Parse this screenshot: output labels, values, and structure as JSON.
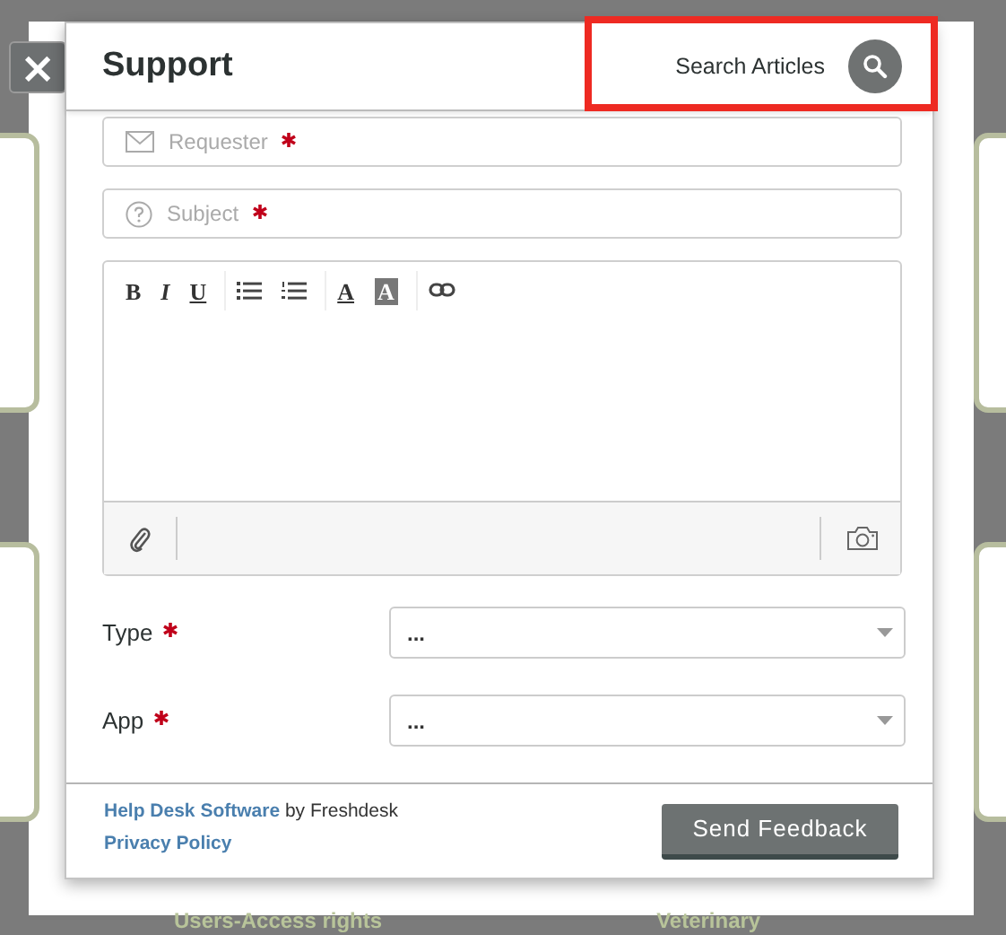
{
  "background": {
    "labels": [
      "Users-Access rights",
      "Veterinary"
    ]
  },
  "close_button": {
    "label": "×"
  },
  "modal": {
    "title": "Support",
    "search": {
      "label": "Search Articles",
      "highlighted": true
    },
    "fields": [
      {
        "kind": "email",
        "placeholder": "Requester",
        "required": true
      },
      {
        "kind": "question",
        "placeholder": "Subject",
        "required": true
      }
    ],
    "editor": {
      "toolbar": [
        [
          {
            "kind": "bold",
            "label": "B"
          },
          {
            "kind": "italic",
            "label": "I"
          },
          {
            "kind": "underline",
            "label": "U"
          }
        ],
        [
          {
            "kind": "bullet-list"
          },
          {
            "kind": "numbered-list"
          }
        ],
        [
          {
            "kind": "text-color",
            "label": "A"
          },
          {
            "kind": "highlight-color",
            "label": "A"
          }
        ],
        [
          {
            "kind": "link"
          }
        ]
      ]
    },
    "selects": [
      {
        "label": "Type",
        "required": true,
        "value": "..."
      },
      {
        "label": "App",
        "required": true,
        "value": "..."
      }
    ],
    "footer": {
      "powered_by": {
        "link": "Help Desk Software",
        "text": "by Freshdesk"
      },
      "privacy_link": "Privacy Policy",
      "submit": "Send Feedback"
    }
  }
}
